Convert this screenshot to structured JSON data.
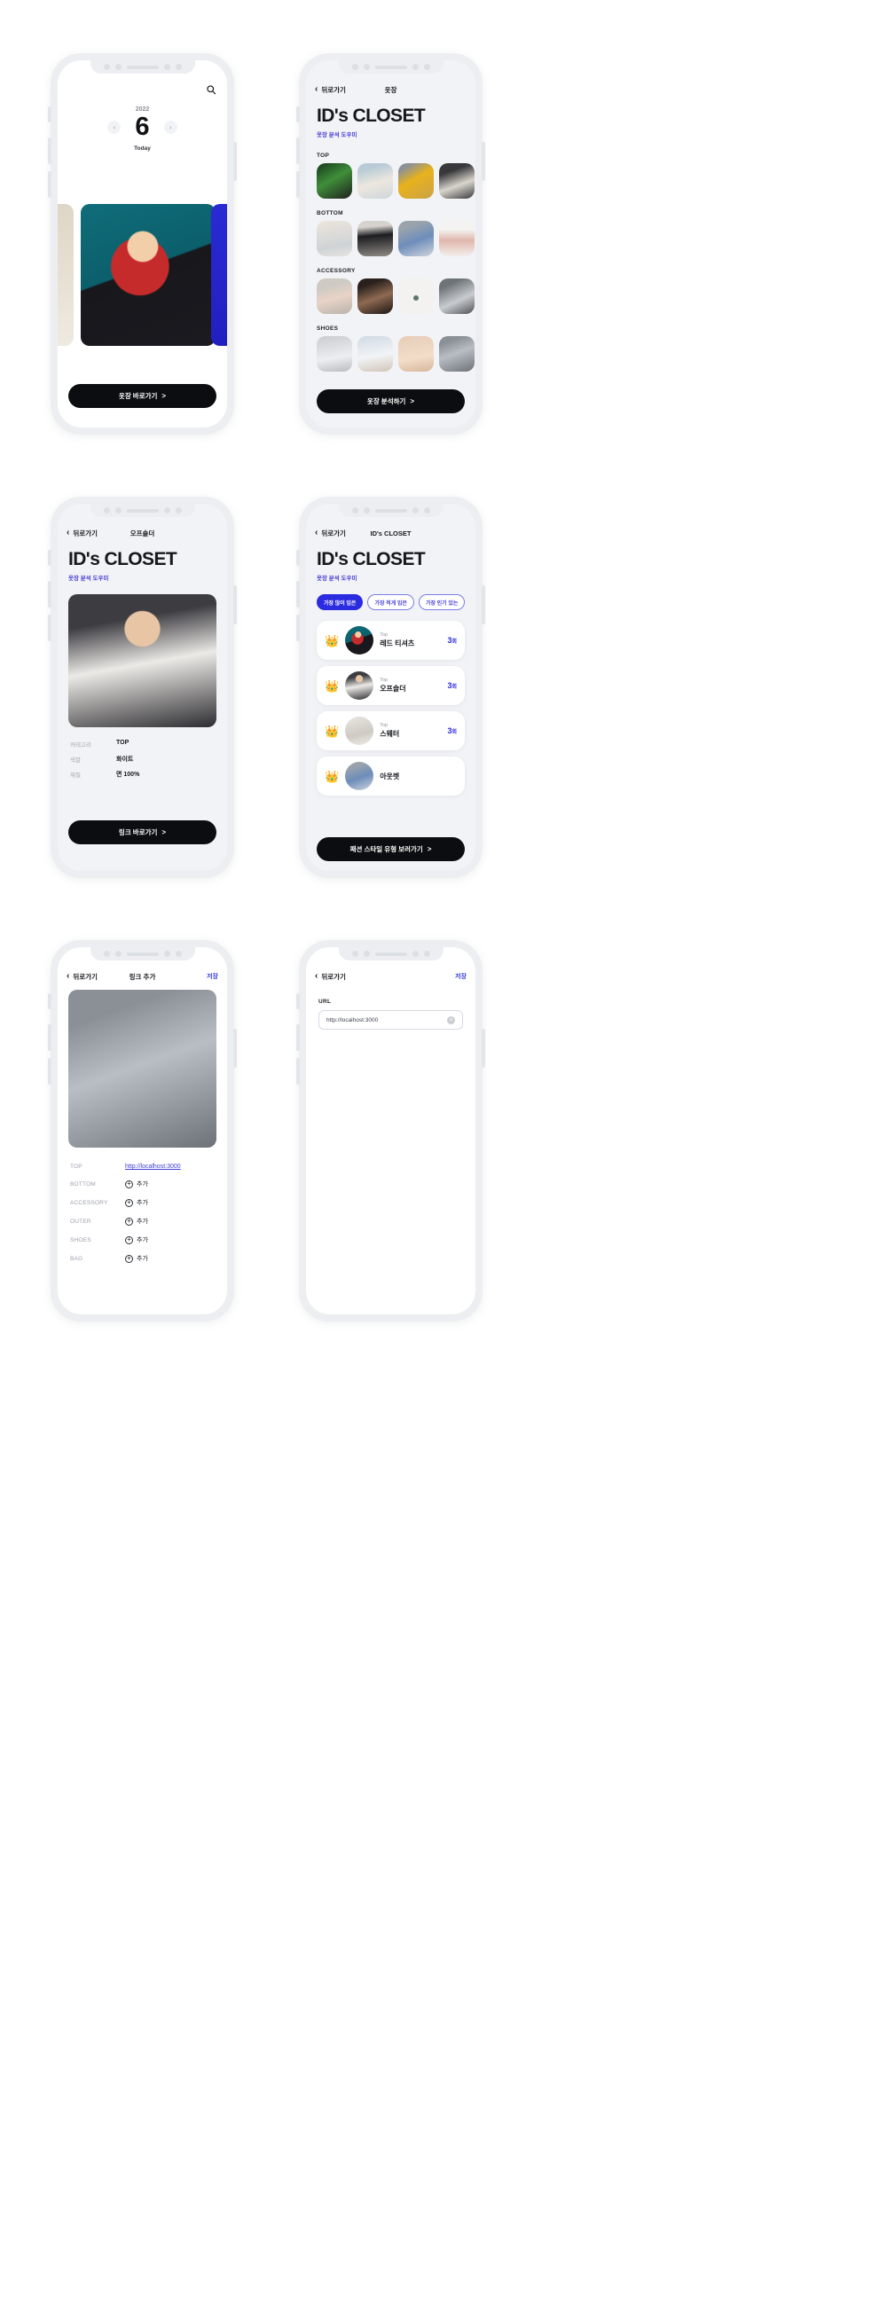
{
  "brand": {
    "title": "ID's CLOSET",
    "subtitle": "옷장 분석 도우미"
  },
  "nav": {
    "back": "뒤로가기",
    "chevron": "‹",
    "save": "저장"
  },
  "phone1": {
    "search_icon": "search-icon",
    "year": "2022",
    "day": "6",
    "today": "Today",
    "prev": "‹",
    "next": "›",
    "cta": "옷장 바로가기",
    "cta_arrow": ">"
  },
  "phone2": {
    "nav_title": "옷장",
    "sections": [
      {
        "label": "TOP",
        "items": [
          "green-jacket",
          "white-knit",
          "yellow-top",
          "off-shoulder"
        ]
      },
      {
        "label": "BOTTOM",
        "items": [
          "white-skirt",
          "black-pants",
          "denim-jeans",
          "pink-pants"
        ]
      },
      {
        "label": "ACCESSORY",
        "items": [
          "sunglasses",
          "earring",
          "round-sunglasses",
          "grey-bag"
        ]
      },
      {
        "label": "SHOES",
        "items": [
          "grey-sneaker",
          "white-shoe",
          "beige-shoe",
          "nude-shoe"
        ]
      }
    ],
    "cta": "옷장 분석하기",
    "cta_arrow": ">"
  },
  "phone3": {
    "nav_title": "오프숄더",
    "hero": "off-shoulder-model-photo",
    "specs": [
      {
        "key": "카테고리",
        "value": "TOP"
      },
      {
        "key": "색깔",
        "value": "화이트"
      },
      {
        "key": "재질",
        "value": "면 100%"
      }
    ],
    "cta": "링크 바로가기",
    "cta_arrow": ">"
  },
  "phone4": {
    "nav_title": "ID's CLOSET",
    "chips": [
      {
        "label": "가장 많이 입은",
        "active": true
      },
      {
        "label": "가장 적게 입은",
        "active": false
      },
      {
        "label": "가장 인기 있는",
        "active": false
      }
    ],
    "ranks": [
      {
        "crown": "gold",
        "category": "Top",
        "name": "레드 티셔츠",
        "count": "3",
        "unit": "회"
      },
      {
        "crown": "silver",
        "category": "Top",
        "name": "오프숄더",
        "count": "3",
        "unit": "회"
      },
      {
        "crown": "bronze",
        "category": "Top",
        "name": "스웨터",
        "count": "3",
        "unit": "회"
      }
    ],
    "partial_row": "아웃렛",
    "cta": "패션 스타일 유형 보러가기",
    "cta_arrow": ">"
  },
  "phone5": {
    "nav_title": "링크 추가",
    "hero": "grey-shirt-model-photo",
    "rows": [
      {
        "key": "TOP",
        "value": "http://localhost:3000",
        "type": "link"
      },
      {
        "key": "BOTTOM",
        "value": "추가",
        "type": "add"
      },
      {
        "key": "ACCESSORY",
        "value": "추가",
        "type": "add"
      },
      {
        "key": "OUTER",
        "value": "추가",
        "type": "add"
      },
      {
        "key": "SHOES",
        "value": "추가",
        "type": "add"
      },
      {
        "key": "BAG",
        "value": "추가",
        "type": "add"
      }
    ]
  },
  "phone6": {
    "field_label": "URL",
    "url_value": "http://localhost:3000",
    "url_placeholder": "http://localhost:3000",
    "clear_icon": "×"
  },
  "colors": {
    "accent": "#2b2be0",
    "accent_soft": "#4a42d6",
    "dark": "#0c0d10",
    "frame": "#eceef1",
    "screen_grey": "#f2f3f6"
  }
}
